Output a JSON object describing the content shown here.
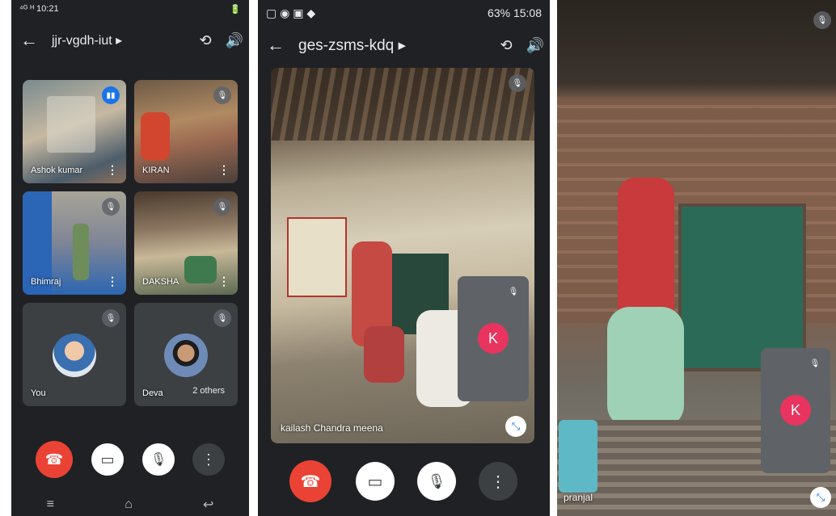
{
  "panel1": {
    "status_time": "10:21",
    "status_left": "⁴ᴳ ᴴ",
    "status_right": "🔋",
    "meeting_code": "jjr-vgdh-iut ▸",
    "tiles": [
      {
        "name": "Ashok kumar"
      },
      {
        "name": "KIRAN"
      },
      {
        "name": "Bhimraj"
      },
      {
        "name": "DAKSHA"
      },
      {
        "name": "You"
      },
      {
        "name": "Deva"
      }
    ],
    "others_label": "2 others"
  },
  "panel2": {
    "status_right": "63%",
    "status_time": "15:08",
    "meeting_code": "ges-zsms-kdq ▸",
    "speaker_name": "kailash Chandra meena",
    "self_initial": "K"
  },
  "panel3": {
    "speaker_name": "pranjal",
    "self_initial": "K"
  },
  "icons": {
    "back": "←",
    "camera_switch": "⟲",
    "speaker": "🔊",
    "mic_off": "🎙",
    "more": "⋮",
    "end_call": "☎",
    "camera_off": "▭",
    "nav_menu": "≡",
    "nav_home": "⌂",
    "nav_back": "↩"
  },
  "colors": {
    "background": "#202124",
    "end_call": "#ea4335",
    "avatar_k": "#e8345f",
    "active_speaker": "#1a73e8"
  }
}
